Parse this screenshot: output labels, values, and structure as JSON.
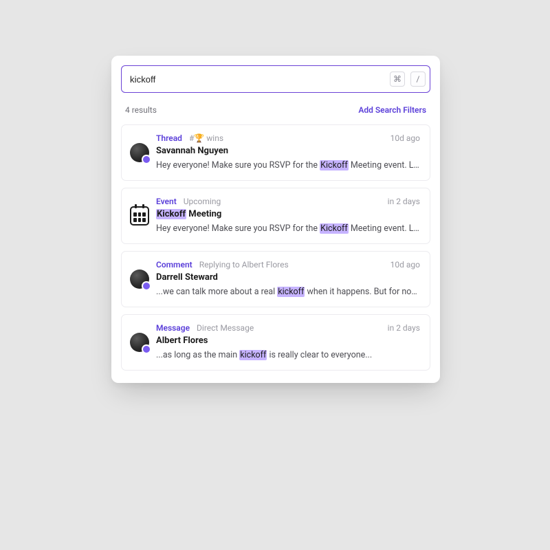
{
  "search": {
    "value": "kickoff",
    "key_hints": {
      "cmd": "⌘",
      "slash": "/"
    }
  },
  "meta": {
    "results_text": "4 results",
    "filters_link": "Add Search Filters"
  },
  "results": [
    {
      "kind": "Thread",
      "sub": "#🏆 wins",
      "time": "10d ago",
      "author": "Savannah Nguyen",
      "snippet_pre": "Hey everyone! Make sure you RSVP for the ",
      "snippet_hit": "Kickoff",
      "snippet_post": " Meeting event. Love seeing all these...",
      "avatar_variant": "dark",
      "badge": "thread"
    },
    {
      "kind": "Event",
      "sub": "Upcoming",
      "time": "in 2 days",
      "title_hit": "Kickoff",
      "title_rest": " Meeting",
      "snippet_pre": "Hey everyone! Make sure you RSVP for the ",
      "snippet_hit": "Kickoff",
      "snippet_post": " Meeting event. Love seeing all these...",
      "icon": "calendar"
    },
    {
      "kind": "Comment",
      "sub": "Replying to Albert Flores",
      "time": "10d ago",
      "author": "Darrell Steward",
      "snippet_pre": "...we can talk more about a real ",
      "snippet_hit": "kickoff",
      "snippet_post": " when it happens. But for now...",
      "avatar_variant": "dark",
      "badge": "comment"
    },
    {
      "kind": "Message",
      "sub": "Direct Message",
      "time": "in 2 days",
      "author": "Albert Flores",
      "snippet_pre": "...as long as the main ",
      "snippet_hit": "kickoff",
      "snippet_post": " is really clear to everyone...",
      "avatar_variant": "dark",
      "badge": "message"
    }
  ]
}
